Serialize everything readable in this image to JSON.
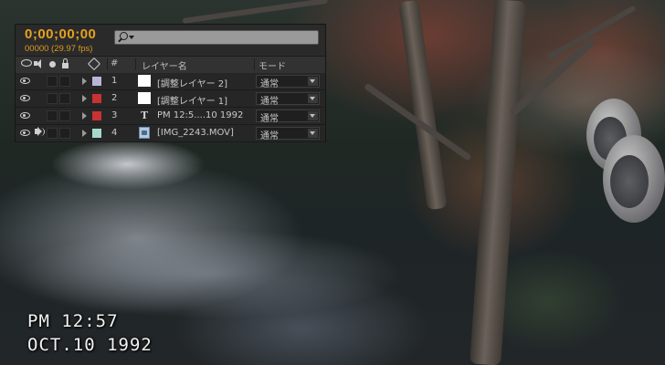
{
  "timeline": {
    "timecode": "0;00;00;00",
    "frame_rate": "00000 (29.97 fps)",
    "search": {
      "value": "",
      "icon": "search-icon"
    }
  },
  "columns": {
    "number": "#",
    "layer_name": "レイヤー名",
    "mode": "モード"
  },
  "layers": [
    {
      "index": "1",
      "name": "[調整レイヤー 2]",
      "label_color": "#b8b6d8",
      "audio": false,
      "type": "adjustment",
      "mode": "通常"
    },
    {
      "index": "2",
      "name": "[調整レイヤー 1]",
      "label_color": "#c83232",
      "audio": false,
      "type": "adjustment",
      "mode": "通常"
    },
    {
      "index": "3",
      "name": "PM 12:5....10 1992",
      "label_color": "#c83232",
      "audio": false,
      "type": "text",
      "mode": "通常"
    },
    {
      "index": "4",
      "name": "[IMG_2243.MOV]",
      "label_color": "#a8d8cc",
      "audio": true,
      "type": "footage",
      "mode": "通常"
    }
  ],
  "overlay": {
    "time": "PM 12:57",
    "date": "OCT.10 1992"
  },
  "colors": {
    "timecode": "#e6a21f",
    "panel_bg": "#2a2a2a"
  }
}
